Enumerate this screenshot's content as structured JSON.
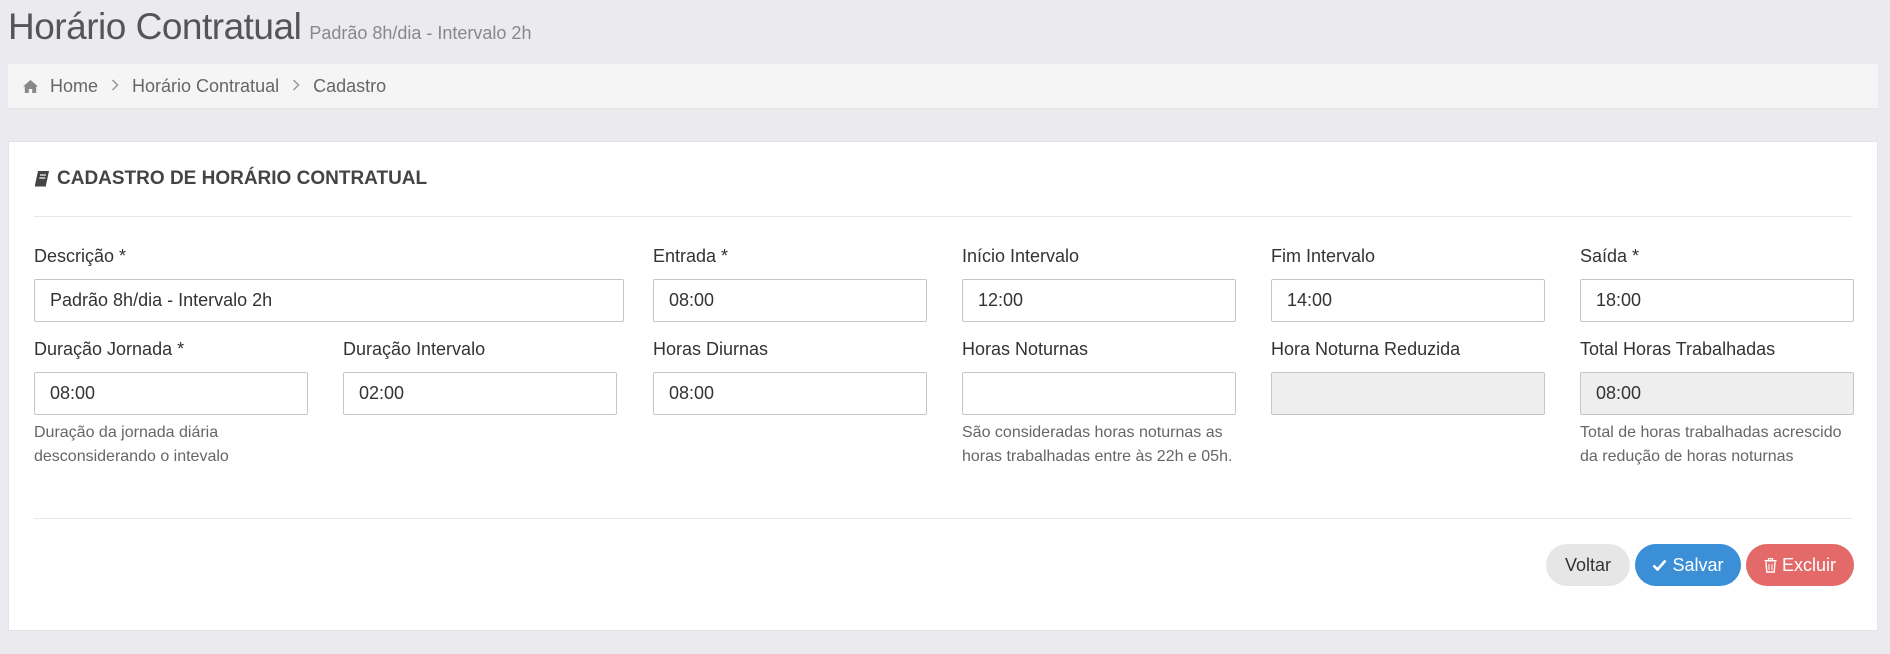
{
  "header": {
    "title": "Horário Contratual",
    "subtitle": "Padrão 8h/dia - Intervalo 2h"
  },
  "breadcrumb": {
    "items": [
      "Home",
      "Horário Contratual",
      "Cadastro"
    ]
  },
  "panel": {
    "heading": "CADASTRO DE HORÁRIO CONTRATUAL"
  },
  "form": {
    "descricao": {
      "label": "Descrição *",
      "value": "Padrão 8h/dia - Intervalo 2h"
    },
    "entrada": {
      "label": "Entrada *",
      "value": "08:00"
    },
    "inicio_intervalo": {
      "label": "Início Intervalo",
      "value": "12:00"
    },
    "fim_intervalo": {
      "label": "Fim Intervalo",
      "value": "14:00"
    },
    "saida": {
      "label": "Saída *",
      "value": "18:00"
    },
    "duracao_jornada": {
      "label": "Duração Jornada *",
      "value": "08:00",
      "help": "Duração da jornada diária desconsiderando o intevalo"
    },
    "duracao_intervalo": {
      "label": "Duração Intervalo",
      "value": "02:00"
    },
    "horas_diurnas": {
      "label": "Horas Diurnas",
      "value": "08:00"
    },
    "horas_noturnas": {
      "label": "Horas Noturnas",
      "value": "",
      "help": "São consideradas horas noturnas as horas trabalhadas entre às 22h e 05h."
    },
    "hora_noturna_reduzida": {
      "label": "Hora Noturna Reduzida",
      "value": ""
    },
    "total_horas": {
      "label": "Total Horas Trabalhadas",
      "value": "08:00",
      "help": "Total de horas trabalhadas acrescido da redução de horas noturnas"
    }
  },
  "buttons": {
    "voltar": "Voltar",
    "salvar": "Salvar",
    "excluir": "Excluir"
  },
  "colors": {
    "primary": "#3a8fd6",
    "danger": "#e46a6a",
    "default": "#e6e6e6"
  },
  "icons": {
    "breadcrumb_home": "home-icon",
    "panel_heading": "book-icon",
    "salvar": "check-icon",
    "excluir": "trash-icon"
  }
}
